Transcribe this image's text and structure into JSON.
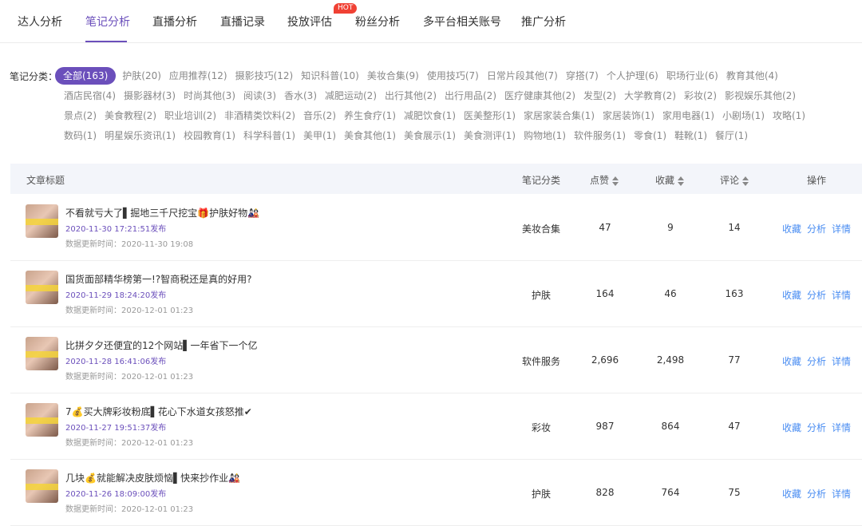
{
  "tabs": [
    "达人分析",
    "笔记分析",
    "直播分析",
    "直播记录",
    "投放评估",
    "粉丝分析",
    "多平台相关账号",
    "推广分析"
  ],
  "hot_badge": "HOT",
  "categories_title": "笔记分类：",
  "category_rows": [
    [
      "全部(163)",
      "护肤(20)",
      "应用推荐(12)",
      "摄影技巧(12)",
      "知识科普(10)",
      "美妆合集(9)",
      "使用技巧(7)",
      "日常片段其他(7)",
      "穿搭(7)",
      "个人护理(6)",
      "职场行业(6)",
      "教育其他(4)"
    ],
    [
      "酒店民宿(4)",
      "摄影器材(3)",
      "时尚其他(3)",
      "阅读(3)",
      "香水(3)",
      "减肥运动(2)",
      "出行其他(2)",
      "出行用品(2)",
      "医疗健康其他(2)",
      "发型(2)",
      "大学教育(2)",
      "彩妆(2)",
      "影视娱乐其他(2)"
    ],
    [
      "景点(2)",
      "美食教程(2)",
      "职业培训(2)",
      "非酒精类饮料(2)",
      "音乐(2)",
      "养生食疗(1)",
      "减肥饮食(1)",
      "医美整形(1)",
      "家居家装合集(1)",
      "家居装饰(1)",
      "家用电器(1)",
      "小剧场(1)",
      "攻略(1)"
    ],
    [
      "数码(1)",
      "明星娱乐资讯(1)",
      "校园教育(1)",
      "科学科普(1)",
      "美甲(1)",
      "美食其他(1)",
      "美食展示(1)",
      "美食测评(1)",
      "购物地(1)",
      "软件服务(1)",
      "零食(1)",
      "鞋靴(1)",
      "餐厅(1)"
    ]
  ],
  "table": {
    "headers": {
      "title": "文章标题",
      "category": "笔记分类",
      "likes": "点赞",
      "collects": "收藏",
      "comments": "评论",
      "actions": "操作"
    },
    "action_labels": [
      "收藏",
      "分析",
      "详情"
    ],
    "rows": [
      {
        "title": "不看就亏大了▌掘地三千尺挖宝🎁护肤好物🎎",
        "published": "2020-11-30 17:21:51发布",
        "updated": "数据更新时间：2020-11-30 19:08",
        "category": "美妆合集",
        "likes": "47",
        "collects": "9",
        "comments": "14"
      },
      {
        "title": "国货面部精华榜第一!?智商税还是真的好用?",
        "published": "2020-11-29 18:24:20发布",
        "updated": "数据更新时间：2020-12-01 01:23",
        "category": "护肤",
        "likes": "164",
        "collects": "46",
        "comments": "163"
      },
      {
        "title": "比拼夕夕还便宜的12个网站▌一年省下一个亿",
        "published": "2020-11-28 16:41:06发布",
        "updated": "数据更新时间：2020-12-01 01:23",
        "category": "软件服务",
        "likes": "2,696",
        "collects": "2,498",
        "comments": "77"
      },
      {
        "title": "7💰买大牌彩妆粉底▌花心下水道女孩怒推✔",
        "published": "2020-11-27 19:51:37发布",
        "updated": "数据更新时间：2020-12-01 01:23",
        "category": "彩妆",
        "likes": "987",
        "collects": "864",
        "comments": "47"
      },
      {
        "title": "几块💰就能解决皮肤烦恼▌快来抄作业🎎",
        "published": "2020-11-26 18:09:00发布",
        "updated": "数据更新时间：2020-12-01 01:23",
        "category": "护肤",
        "likes": "828",
        "collects": "764",
        "comments": "75"
      }
    ]
  },
  "colors": {
    "accent": "#6b4fbb",
    "link": "#4a8df2",
    "hot": "#f04134"
  }
}
